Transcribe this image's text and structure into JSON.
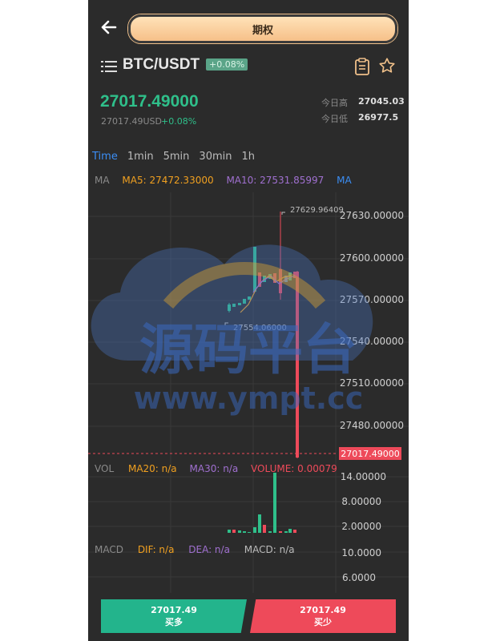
{
  "header": {
    "title": "期权"
  },
  "pair": {
    "name": "BTC/USDT",
    "change_badge": "+0.08%"
  },
  "price": {
    "last": "27017.49000",
    "usd": "27017.49USD",
    "change": "+0.08%"
  },
  "stats": {
    "high_label": "今日高",
    "high_value": "27045.03",
    "low_label": "今日低",
    "low_value": "26977.5"
  },
  "tabs": [
    "Time",
    "1min",
    "5min",
    "30min",
    "1h"
  ],
  "ma_row": {
    "label": "MA",
    "ma5": "MA5: 27472.33000",
    "ma10": "MA10: 27531.85997",
    "ma_cut": "MA"
  },
  "price_axis": [
    "27630.00000",
    "27600.00000",
    "27570.00000",
    "27540.00000",
    "27510.00000",
    "27480.00000"
  ],
  "chart_annotations": {
    "high": "27629.96409",
    "low": "27554.06000",
    "current": "27017.49000"
  },
  "vol_row": {
    "label": "VOL",
    "ma20": "MA20: n/a",
    "ma30": "MA30: n/a",
    "volume": "VOLUME: 0.00079"
  },
  "vol_axis": [
    "14.00000",
    "8.00000",
    "2.00000"
  ],
  "macd_row": {
    "label": "MACD",
    "dif": "DIF: n/a",
    "dea": "DEA: n/a",
    "macd": "MACD: n/a"
  },
  "macd_axis": [
    "10.0000",
    "6.0000"
  ],
  "buy": {
    "price": "27017.49",
    "label": "买多"
  },
  "sell": {
    "price": "27017.49",
    "label": "买少"
  },
  "watermark": {
    "line1": "源码平台",
    "line2": "www.ympt.cc"
  },
  "colors": {
    "up": "#2fbf8a",
    "down": "#ee4a5a",
    "accent": "#3b8ef5",
    "ma5": "#f0a020",
    "ma10": "#a070d0"
  }
}
